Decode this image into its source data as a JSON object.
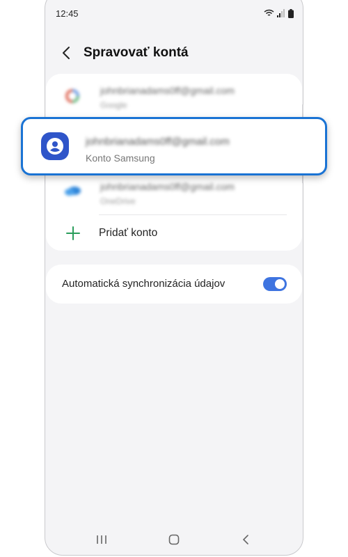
{
  "status_bar": {
    "time": "12:45"
  },
  "header": {
    "back_icon": "chevron-left-icon",
    "title": "Spravovať kontá"
  },
  "accounts": [
    {
      "email": "johnbrianadams0ff@gmail.com",
      "type": "Google",
      "icon": "google-icon"
    },
    {
      "email": "johnbrianadams0ff@gmail.com",
      "type": "Konto Samsung",
      "icon": "samsung-account-icon"
    },
    {
      "email": "johnbrianadams0ff@gmail.com",
      "type": "OneDrive",
      "icon": "onedrive-icon"
    }
  ],
  "add_account": {
    "label": "Pridať konto",
    "icon": "plus-icon"
  },
  "sync": {
    "label": "Automatická synchronizácia údajov",
    "enabled": true
  },
  "colors": {
    "accent": "#1a73d4",
    "toggle_on": "#3e74e0",
    "samsung_icon_bg": "#2f55c9",
    "add_icon": "#2a9d5b",
    "background": "#f4f4f6"
  },
  "navbar": {
    "recents_icon": "recents-icon",
    "home_icon": "home-icon",
    "back_icon": "back-nav-icon"
  }
}
